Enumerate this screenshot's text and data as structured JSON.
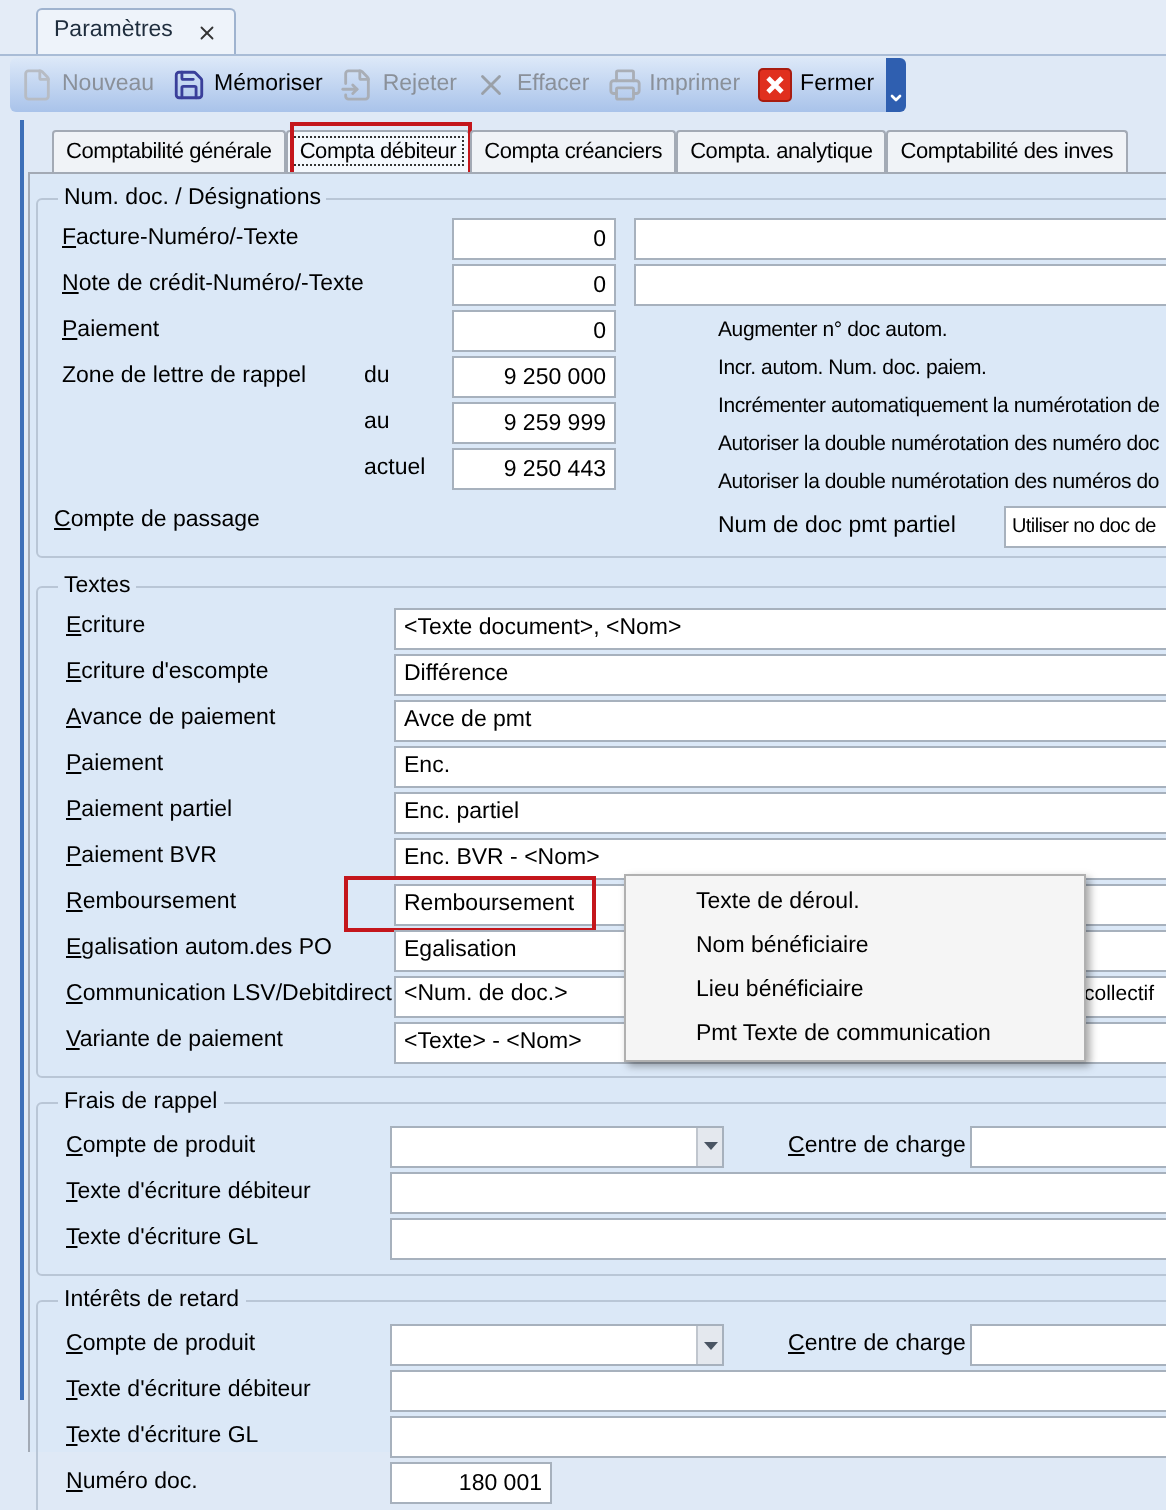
{
  "window_tab": {
    "title": "Paramètres"
  },
  "toolbar": [
    {
      "label": "Nouveau",
      "disabled": true
    },
    {
      "label": "Mémoriser",
      "disabled": false
    },
    {
      "label": "Rejeter",
      "disabled": true
    },
    {
      "label": "Effacer",
      "disabled": true
    },
    {
      "label": "Imprimer",
      "disabled": true
    },
    {
      "label": "Fermer",
      "disabled": false
    }
  ],
  "tabs": [
    {
      "label": "Comptabilité générale",
      "selected": false,
      "highlighted": false
    },
    {
      "label": "Compta débiteur",
      "selected": true,
      "highlighted": true
    },
    {
      "label": "Compta créanciers",
      "selected": false,
      "highlighted": false
    },
    {
      "label": "Compta. analytique",
      "selected": false,
      "highlighted": false
    },
    {
      "label": "Comptabilité des inves",
      "selected": false,
      "highlighted": false
    }
  ],
  "numbering": {
    "title": "Num. doc. / Désignations",
    "top_rows": [
      {
        "label": "Facture-Numéro/-Texte",
        "value": "0"
      },
      {
        "label": "Note de crédit-Numéro/-Texte",
        "value": "0"
      }
    ],
    "rows": [
      {
        "label": "Paiement",
        "key_underlined": true,
        "value": "0"
      },
      {
        "label": "Zone de lettre de rappel",
        "key_underlined": false,
        "sublabel": "du",
        "value": "9 250 000"
      },
      {
        "sublabel": "au",
        "value": "9 259 999"
      },
      {
        "sublabel": "actuel",
        "value": "9 250 443"
      }
    ],
    "passage_label": "Compte de passage",
    "options": [
      "Augmenter n° doc autom.",
      "Incr. autom. Num. doc. paiem.",
      "Incrémenter automatiquement la numérotation de",
      "Autoriser la double numérotation des numéro doc",
      "Autoriser la double numérotation des numéros do"
    ],
    "partial": {
      "label": "Num de doc pmt partiel",
      "value": "Utiliser no doc de"
    }
  },
  "texts": {
    "title": "Textes",
    "rows": [
      {
        "label": "Ecriture",
        "value": "<Texte document>, <Nom>",
        "highlighted": false
      },
      {
        "label": "Ecriture d'escompte",
        "value": "Différence",
        "highlighted": false
      },
      {
        "label": "Avance de paiement",
        "value": "Avce de pmt",
        "highlighted": false
      },
      {
        "label": "Paiement",
        "value": "Enc.",
        "highlighted": false
      },
      {
        "label": "Paiement partiel",
        "value": "Enc. partiel",
        "highlighted": false
      },
      {
        "label": "Paiement BVR",
        "value": "Enc. BVR - <Nom>",
        "highlighted": false
      },
      {
        "label": "Remboursement",
        "value": "Remboursement",
        "highlighted": true
      },
      {
        "label": "Egalisation autom.des PO",
        "value": "Egalisation",
        "highlighted": false
      },
      {
        "label": "Communication LSV/Debitdirect",
        "value": "<Num. de doc.>",
        "value_tail": "collectif",
        "highlighted": false
      },
      {
        "label": "Variante de paiement",
        "value": "<Texte> - <Nom>",
        "highlighted": false
      }
    ]
  },
  "context_menu": [
    "Texte de déroul.",
    "Nom bénéficiaire",
    "Lieu bénéficiaire",
    "Pmt Texte de communication"
  ],
  "reminder_fees": {
    "title": "Frais de rappel",
    "product_account": "Compte de produit",
    "cost_center": "Centre de charge",
    "rows": [
      "Texte d'écriture débiteur",
      "Texte d'écriture GL"
    ]
  },
  "late_interest": {
    "title": "Intérêts de retard",
    "product_account": "Compte de produit",
    "cost_center": "Centre de charge",
    "rows": [
      "Texte d'écriture débiteur",
      "Texte d'écriture GL"
    ],
    "doc_number": {
      "label": "Numéro doc.",
      "value": "180 001"
    }
  }
}
